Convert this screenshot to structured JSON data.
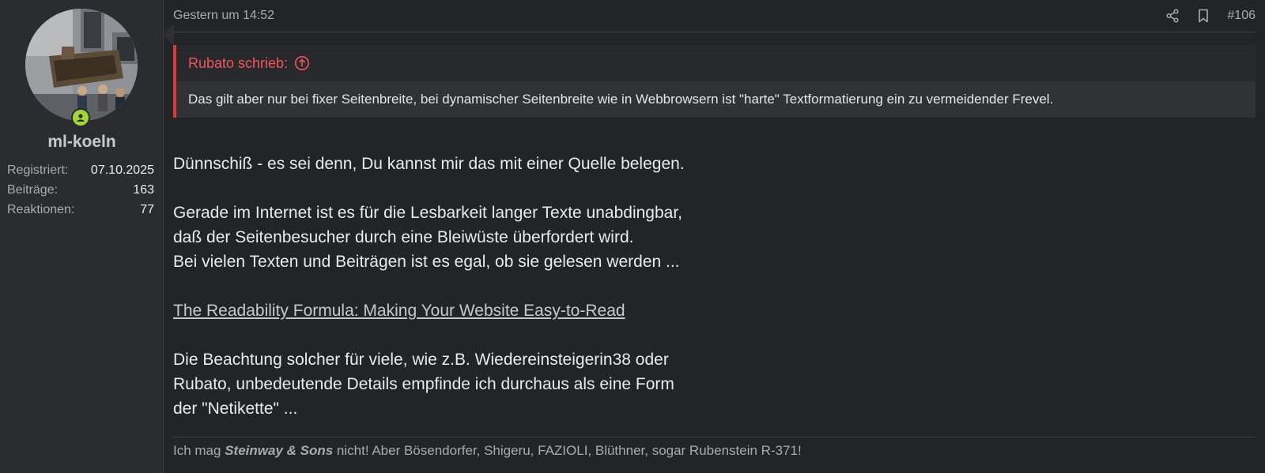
{
  "user": {
    "username": "ml-koeln",
    "stats": [
      {
        "label": "Registriert:",
        "value": "07.10.2025"
      },
      {
        "label": "Beiträge:",
        "value": "163"
      },
      {
        "label": "Reaktionen:",
        "value": "77"
      }
    ],
    "online_color": "#a3d739"
  },
  "post": {
    "date": "Gestern um 14:52",
    "number": "#106",
    "icons": [
      "share-icon",
      "bookmark-icon"
    ]
  },
  "quote": {
    "author": "Rubato schrieb:",
    "text": "Das gilt aber nur bei fixer Seitenbreite, bei dynamischer Seitenbreite wie in Webbrowsern ist \"harte\" Textformatierung ein zu vermeidender Frevel.",
    "accent": "#e0373e"
  },
  "content": {
    "p1": "Dünnschiß - es sei denn, Du kannst mir das mit einer Quelle belegen.",
    "p2_l1": "Gerade im Internet ist es für die Lesbarkeit langer Texte unabdingbar,",
    "p2_l2": "daß der Seitenbesucher durch eine Bleiwüste überfordert wird.",
    "p2_l3": "Bei vielen Texten und Beiträgen ist es egal, ob sie gelesen werden ...",
    "link": "The Readability Formula: Making Your Website Easy-to-Read",
    "p3_l1": "Die Beachtung solcher für viele, wie z.B. Wiedereinsteigerin38 oder",
    "p3_l2": "Rubato, unbedeutende Details empfinde ich durchaus als eine Form",
    "p3_l3": "der \"Netikette\" ..."
  },
  "signature": {
    "prefix": "Ich mag ",
    "brand": "Steinway & Sons",
    "suffix": " nicht! Aber Bösendorfer, Shigeru, FAZIOLI, Blüthner, sogar Rubenstein R-371!"
  }
}
